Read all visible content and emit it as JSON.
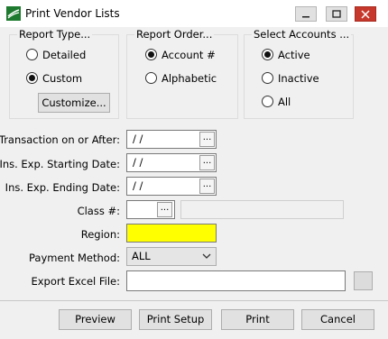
{
  "window": {
    "title": "Print Vendor Lists",
    "controls": [
      "minimize",
      "maximize",
      "close"
    ]
  },
  "report_type": {
    "title": "Report Type...",
    "options": [
      {
        "label": "Detailed",
        "checked": false
      },
      {
        "label": "Custom",
        "checked": true
      }
    ],
    "customize_label": "Customize..."
  },
  "report_order": {
    "title": "Report Order...",
    "options": [
      {
        "label": "Account #",
        "checked": true
      },
      {
        "label": "Alphabetic",
        "checked": false
      }
    ]
  },
  "select_accounts": {
    "title": "Select Accounts ...",
    "options": [
      {
        "label": "Active",
        "checked": true
      },
      {
        "label": "Inactive",
        "checked": false
      },
      {
        "label": "All",
        "checked": false
      }
    ]
  },
  "form": {
    "transaction_label": "Transaction on or After:",
    "transaction_value": " /  /",
    "starting_label": "Ins. Exp. Starting Date:",
    "starting_value": " /  /",
    "ending_label": "Ins. Exp. Ending Date:",
    "ending_value": " /  /",
    "class_label": "Class #:",
    "class_value": "",
    "class_description": "",
    "region_label": "Region:",
    "region_value": "",
    "payment_label": "Payment Method:",
    "payment_value": "ALL",
    "export_label": "Export Excel File:",
    "export_value": "",
    "ellipsis": "..."
  },
  "footer": {
    "preview": "Preview",
    "print_setup": "Print Setup",
    "print": "Print",
    "cancel": "Cancel"
  },
  "colors": {
    "region_highlight": "#ffff00",
    "close_button": "#c6382b"
  }
}
